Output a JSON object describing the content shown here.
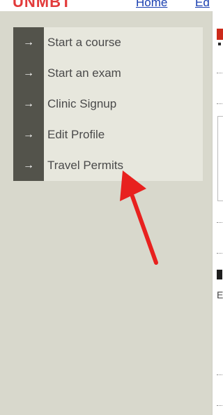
{
  "header": {
    "brand": "UNMBT",
    "links": [
      "Home",
      "Ed"
    ]
  },
  "menu": {
    "items": [
      {
        "label": "Start a course",
        "icon": "arrow-right"
      },
      {
        "label": "Start an exam",
        "icon": "arrow-right"
      },
      {
        "label": "Clinic Signup",
        "icon": "arrow-right"
      },
      {
        "label": "Edit Profile",
        "icon": "arrow-right"
      },
      {
        "label": "Travel Permits",
        "icon": "arrow-right"
      }
    ]
  },
  "content": {
    "letter": "E"
  },
  "annotation": {
    "color": "#e8211f",
    "target": "Travel Permits"
  }
}
